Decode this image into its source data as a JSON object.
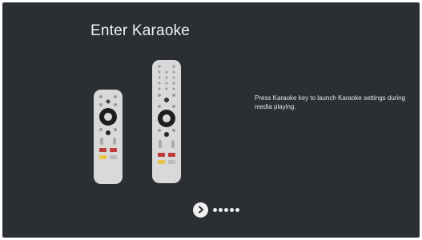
{
  "page": {
    "title": "Enter Karaoke",
    "description": "Press Karaoke key to launch Karaoke settings during media playing."
  },
  "illustration": {
    "small_remote": "remote-small",
    "large_remote": "remote-large"
  },
  "pager": {
    "next_icon": "chevron-right-icon",
    "dot_count": 5,
    "current_step": 1,
    "colors": {
      "dot": "#f0f0f0",
      "button": "#f0f0f0",
      "background": "#2b2e33"
    }
  }
}
